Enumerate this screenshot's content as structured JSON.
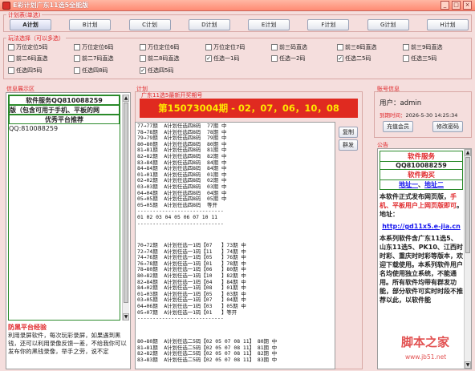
{
  "window": {
    "title": "E彩计划广东11选5全能版",
    "buttons": [
      "_",
      "□",
      "×"
    ]
  },
  "plans": {
    "label": "计划表(单选)",
    "items": [
      "A计划",
      "B计划",
      "C计划",
      "D计划",
      "E计划",
      "F计划",
      "G计划",
      "H计划"
    ],
    "active": "A计划"
  },
  "modes": {
    "label": "玩法选择（可以多选）",
    "options": [
      {
        "label": "万位定位5码",
        "checked": false
      },
      {
        "label": "万位定位6码",
        "checked": false
      },
      {
        "label": "万位定位6码",
        "checked": false
      },
      {
        "label": "万位定位7码",
        "checked": false
      },
      {
        "label": "前三码直选",
        "checked": false
      },
      {
        "label": "前三8码直选",
        "checked": false
      },
      {
        "label": "前三9码直选",
        "checked": false
      },
      {
        "label": "前二6码直选",
        "checked": false
      },
      {
        "label": "前二7码直选",
        "checked": false
      },
      {
        "label": "前二8码直选",
        "checked": false
      },
      {
        "label": "任选一1码",
        "checked": true
      },
      {
        "label": "任选一2码",
        "checked": false
      },
      {
        "label": "任选二5码",
        "checked": true
      },
      {
        "label": "任选三5码",
        "checked": false
      },
      {
        "label": "任选四5码",
        "checked": false
      },
      {
        "label": "任选四8码",
        "checked": false
      },
      {
        "label": "任选四5码",
        "checked": true
      }
    ]
  },
  "info": {
    "label": "信息展示区",
    "service": "软件服务QQ810088259",
    "marquee": "版（包含可用于手机、平板的网",
    "recommend": "优秀平台推荐",
    "qq": "QQ:810088259",
    "exp_title": "防黑平台经验",
    "exp_text": "利用录屏软件，每次玩彩录屏，如果遇到黑钱，还可以利用录像反馈一差，不给我你可以发布你的黑钱录像，举手之劳，说不定"
  },
  "plan_area": {
    "label": "计划",
    "sub_label": "广东11选5最新开奖期号",
    "period": "第15073004期 - 02，07，06，10，08",
    "copy_btn": "复制",
    "group_btn": "群发",
    "block1": [
      "77→77期  A计划任选四8码  77期 中",
      "78→78期  A计划任选四8码  78期 中",
      "79→79期  A计划任选四8码  79期 中",
      "80→80期  A计划任选四8码  80期 中",
      "81→81期  A计划任选四8码  81期 中",
      "82→82期  A计划任选四8码  82期 中",
      "83→84期  A计划任选四8码  84期 中",
      "84→84期  A计划任选四8码  84期 中",
      "01→01期  A计划任选四8码  01期 中",
      "02→02期  A计划任选四8码  02期 中",
      "03→03期  A计划任选四8码  03期 中",
      "04→04期  A计划任选四8码  04期 中",
      "05→05期  A计划任选四8码  05期 中",
      "05→05期  A计划任选四8码  等开",
      "----------------------------",
      "01 02 03 04 05 06 07 10 11",
      "----------------------------"
    ],
    "block2": [
      "70→72期  A计划任选一1码【07   】73期 中",
      "72→74期  A计划任选一1码【11   】74期 中",
      "74→76期  A计划任选一1码【05   】76期 中",
      "76→78期  A计划任选一1码【01   】78期 中",
      "78→80期  A计划任选一1码【06   】80期 中",
      "80→82期  A计划任选一1码【10   】82期 中",
      "82→84期  A计划任选一1码【04   】84期 中",
      "84→02期  A计划任选一1码【08   】01期 中",
      "01→03期  A计划任选一1码【05   】03期 中",
      "03→05期  A计划任选一1码【07   】04期 中",
      "04→06期  A计划任选一1码【03   】05期 中",
      "05→07期  A计划任选一1码【01   】等开",
      "----------------------------"
    ],
    "block3": [
      "80→80期  A计划任选二5码【02 05 07 08 11】 80期 中",
      "81→81期  A计划任选二5码【02 05 07 08 11】 81期 中",
      "82→82期  A计划任选二5码【02 05 07 08 11】 82期 中",
      "83→83期  A计划任选二5码【02 05 07 08 11】 83期 中"
    ]
  },
  "account": {
    "label": "账号信息",
    "user": "用户：admin",
    "expire_label": "到期时间：",
    "expire_value": "2026-5-30 14:25:34",
    "recharge_btn": "充值会员",
    "change_pwd_btn": "修改密码"
  },
  "notice": {
    "label": "公告",
    "service_title": "软件服务",
    "service_qq": "QQ810088259",
    "buy_title": "软件购买",
    "addr1": "地址一",
    "addr_sep": "、",
    "addr2": "地址二",
    "text1": "本软件正式发布网页版，",
    "text1_red": "手机、平板用户上网页版即可",
    "text1_end": "。地址：",
    "link": "http://gd11x5.e-jia.cn",
    "text2": "本系列软件含广东11选5、山东11选5、PK10、江西时时彩、重庆时时彩等版本，欢迎下载使用。本系列软件用户名均使用独立系统，不能通用。所有软件均带有群发功能，部分软件可实时时段不推荐以此，以软件能"
  },
  "watermark": {
    "text": "脚本之家",
    "url": "www.jb51.net"
  },
  "colors": {
    "accent": "#e0282b",
    "bg": "#f5dedd",
    "panel_border": "#2a8a2a",
    "link": "#1a1aee"
  }
}
